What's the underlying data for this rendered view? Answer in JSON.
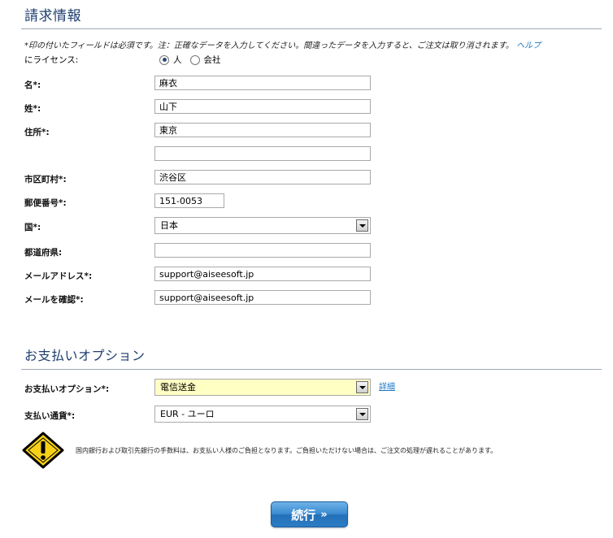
{
  "billing": {
    "title": "請求情報",
    "notice": "*印の付いたフィールドは必須です。注：正確なデータを入力してください。間違ったデータを入力すると、ご注文は取り消されます。",
    "help_link": "ヘルプ",
    "license": {
      "label": "にライセンス:",
      "options": [
        "人",
        "会社"
      ],
      "selected": "人"
    },
    "fields": {
      "first_name": {
        "label": "名*:",
        "value": "麻衣"
      },
      "last_name": {
        "label": "姓*:",
        "value": "山下"
      },
      "address": {
        "label": "住所*:",
        "value": "東京"
      },
      "address2": {
        "value": ""
      },
      "city": {
        "label": "市区町村*:",
        "value": "渋谷区"
      },
      "postal": {
        "label": "郵便番号*:",
        "value": "151-0053"
      },
      "country": {
        "label": "国*:",
        "value": "日本"
      },
      "prefecture": {
        "label": "都道府県:",
        "value": ""
      },
      "email": {
        "label": "メールアドレス*:",
        "value": "support@aiseesoft.jp"
      },
      "email_confirm": {
        "label": "メールを確認*:",
        "value": "support@aiseesoft.jp"
      }
    }
  },
  "payment": {
    "title": "お支払いオプション",
    "option": {
      "label": "お支払いオプション*:",
      "value": "電信送金"
    },
    "detail_link": "詳細",
    "currency": {
      "label": "支払い通貨*:",
      "value": "EUR - ユーロ"
    },
    "warning": "国内銀行および取引先銀行の手数料は、お支払い人様のご負担となります。ご負担いただけない場合は、ご注文の処理が遅れることがあります。"
  },
  "continue_button": {
    "label": "続行",
    "arrows": "»"
  },
  "colors": {
    "title": "#1f3f6f",
    "link": "#1b78c4",
    "button": "#2b7cc4",
    "highlight": "#ffffc4",
    "warning": "#f7d117"
  }
}
